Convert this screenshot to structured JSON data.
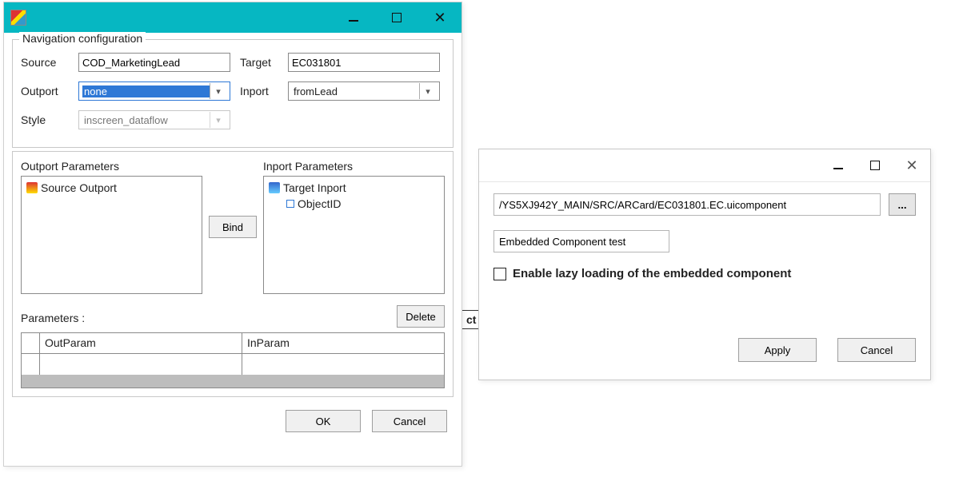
{
  "nav_dialog": {
    "group_title": "Navigation configuration",
    "labels": {
      "source": "Source",
      "target": "Target",
      "outport": "Outport",
      "inport": "Inport",
      "style": "Style"
    },
    "fields": {
      "source": "COD_MarketingLead",
      "target": "EC031801",
      "outport": "none",
      "inport": "fromLead",
      "style": "inscreen_dataflow"
    },
    "outport_panel": {
      "title": "Outport Parameters",
      "root_item": "Source Outport"
    },
    "inport_panel": {
      "title": "Inport Parameters",
      "root_item": "Target Inport",
      "child_item": "ObjectID"
    },
    "bind_button": "Bind",
    "parameters_label": "Parameters  :",
    "delete_button": "Delete",
    "table": {
      "col_out": "OutParam",
      "col_in": "InParam"
    },
    "footer": {
      "ok": "OK",
      "cancel": "Cancel"
    }
  },
  "ec_dialog": {
    "path": "/YS5XJ942Y_MAIN/SRC/ARCard/EC031801.EC.uicomponent",
    "browse": "...",
    "description": "Embedded Component test",
    "lazy_label": "Enable lazy loading of the embedded component",
    "footer": {
      "apply": "Apply",
      "cancel": "Cancel"
    }
  },
  "stub_text": "ct"
}
